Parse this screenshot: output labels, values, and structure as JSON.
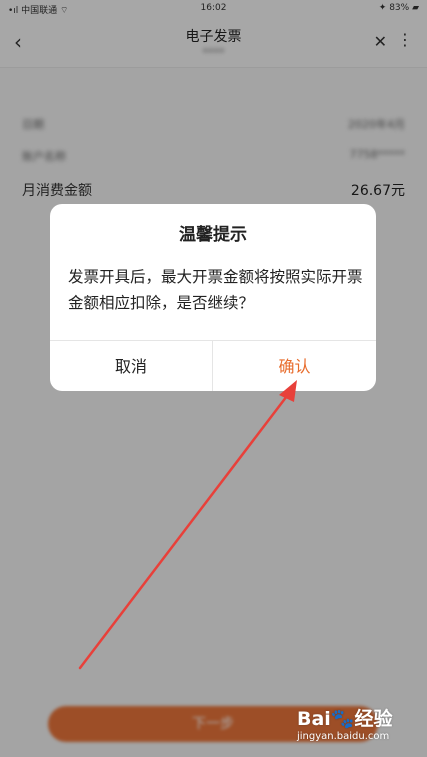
{
  "status_bar": {
    "left": "•ıl 中国联通 ⌔",
    "time": "16:02",
    "right": "✦ 83% ▰"
  },
  "nav": {
    "title": "电子发票",
    "subtitle": "****",
    "back_icon": "chevron-left-icon",
    "close_icon": "close-icon",
    "more_icon": "more-icon"
  },
  "info_rows": [
    {
      "label": "日期",
      "value": "2020年4月"
    },
    {
      "label": "账户名称",
      "value": "7758*****"
    },
    {
      "label": "月消费金额",
      "value": "26.67元"
    }
  ],
  "next_button": {
    "label": "下一步"
  },
  "dialog": {
    "title": "温馨提示",
    "message": "发票开具后，最大开票金额将按照实际开票金额相应扣除，是否继续？",
    "cancel_label": "取消",
    "confirm_label": "确认"
  },
  "watermark": {
    "logo_text": "Bai🐾经验",
    "url": "jingyan.baidu.com"
  },
  "colors": {
    "accent": "#e86c2c",
    "arrow": "#e8403a",
    "overlay": "rgba(0,0,0,0.32)"
  }
}
